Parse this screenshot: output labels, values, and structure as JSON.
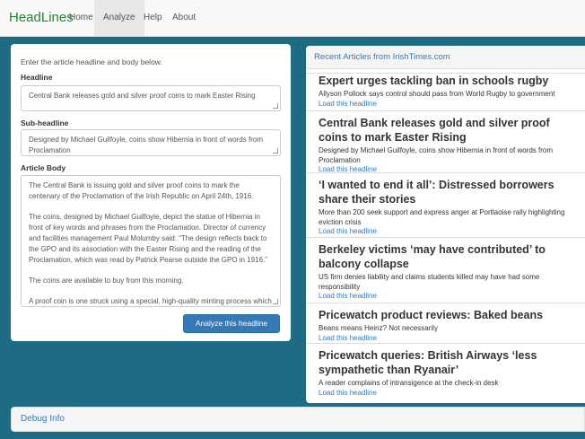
{
  "nav": {
    "brand": "HeadLines",
    "links": [
      "Home",
      "Analyze",
      "Help",
      "About"
    ]
  },
  "form": {
    "intro": "Enter the article headline and body below.",
    "headline_label": "Headline",
    "headline_value": "Central Bank releases gold and silver proof coins to mark Easter Rising",
    "subheadline_label": "Sub-headline",
    "subheadline_value": "Designed by Michael Guilfoyle, coins show Hibernia in front of words from Proclamation",
    "body_label": "Article Body",
    "body_paragraphs": [
      "The Central Bank is issuing gold and silver proof coins to mark the centenary of the Proclamation of the Irish Republic on April 24th, 1916.",
      "The coins, designed by Michael Guilfoyle, depict the statue of Hibernia in front of key words and phrases from the Proclamation. Director of currency and facilities management Paul Molumby said: “The design reflects back to the GPO and its association with the Easter Rising and the reading of the Proclamation, which was read by Patrick Pearse outside the GPO in 1916.”",
      "The coins are available to buy from this morning.",
      "A proof coin is one struck using a special, high-quality minting process which is made especially for collectors. It comes with a numbered certificate of"
    ],
    "submit_label": "Analyze this headline"
  },
  "recent": {
    "title": "Recent Articles from IrishTimes.com",
    "articles": [
      {
        "title": "Expert urges tackling ban in schools rugby",
        "sub": "Allyson Pollock says control should pass from World Rugby to government",
        "link": "Load this headline"
      },
      {
        "title": "Central Bank releases gold and silver proof coins to mark Easter Rising",
        "sub": "Designed by Michael Guilfoyle, coins show Hibernia in front of words from Proclamation",
        "link": "Load this headline"
      },
      {
        "title": "‘I wanted to end it all’: Distressed borrowers share their stories",
        "sub": "More than 200 seek support and express anger at Portlaoise rally highlighting eviction crisis",
        "link": "Load this headline"
      },
      {
        "title": "Berkeley victims ‘may have contributed’ to balcony collapse",
        "sub": "US firm denies liability and claims students killed may have had some responsibility",
        "link": "Load this headline"
      },
      {
        "title": "Pricewatch product reviews: Baked beans",
        "sub": "Beans means Heinz? Not necessarily",
        "link": "Load this headline"
      },
      {
        "title": "Pricewatch queries: British Airways ‘less sympathetic than Ryanair’",
        "sub": "A reader complains of intransigence at the check-in desk",
        "link": "Load this headline"
      }
    ]
  },
  "debug": {
    "label": "Debug Info"
  }
}
